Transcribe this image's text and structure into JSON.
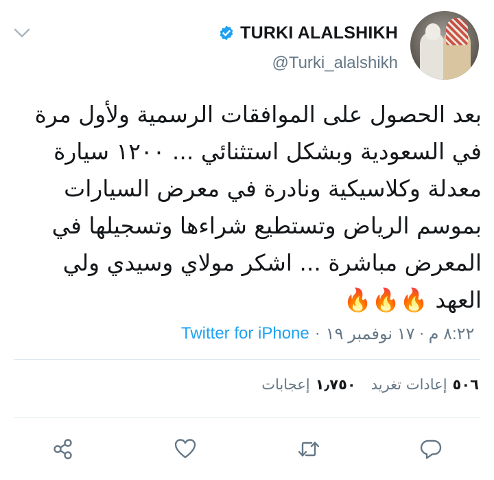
{
  "tweet": {
    "display_name": "TURKI ALALSHIKH",
    "handle": "@Turki_alalshikh",
    "verified_icon": "verified-badge-icon",
    "text": "بعد الحصول على الموافقات الرسمية ولأول مرة في السعودية وبشكل استثنائي ... ١٢٠٠ سيارة معدلة وكلاسيكية ونادرة في معرض السيارات بموسم الرياض وتستطيع شراءها وتسجيلها في المعرض مباشرة ... اشكر مولاي وسيدي ولي العهد 🔥🔥🔥",
    "time": "٨:٢٢ م",
    "date": "١٧ نوفمبر ١٩",
    "separator": "·",
    "source": "Twitter for iPhone"
  },
  "stats": {
    "retweets_count": "٥٠٦",
    "retweets_label": "إعادات تغريد",
    "likes_count": "١٫٧٥٠",
    "likes_label": "إعجابات"
  },
  "actions": {
    "icons": [
      "share-icon",
      "heart-icon",
      "retweet-icon",
      "reply-icon"
    ]
  },
  "colors": {
    "accent": "#1da1f2",
    "secondary_text": "#657786",
    "action_icon": "#657786"
  }
}
